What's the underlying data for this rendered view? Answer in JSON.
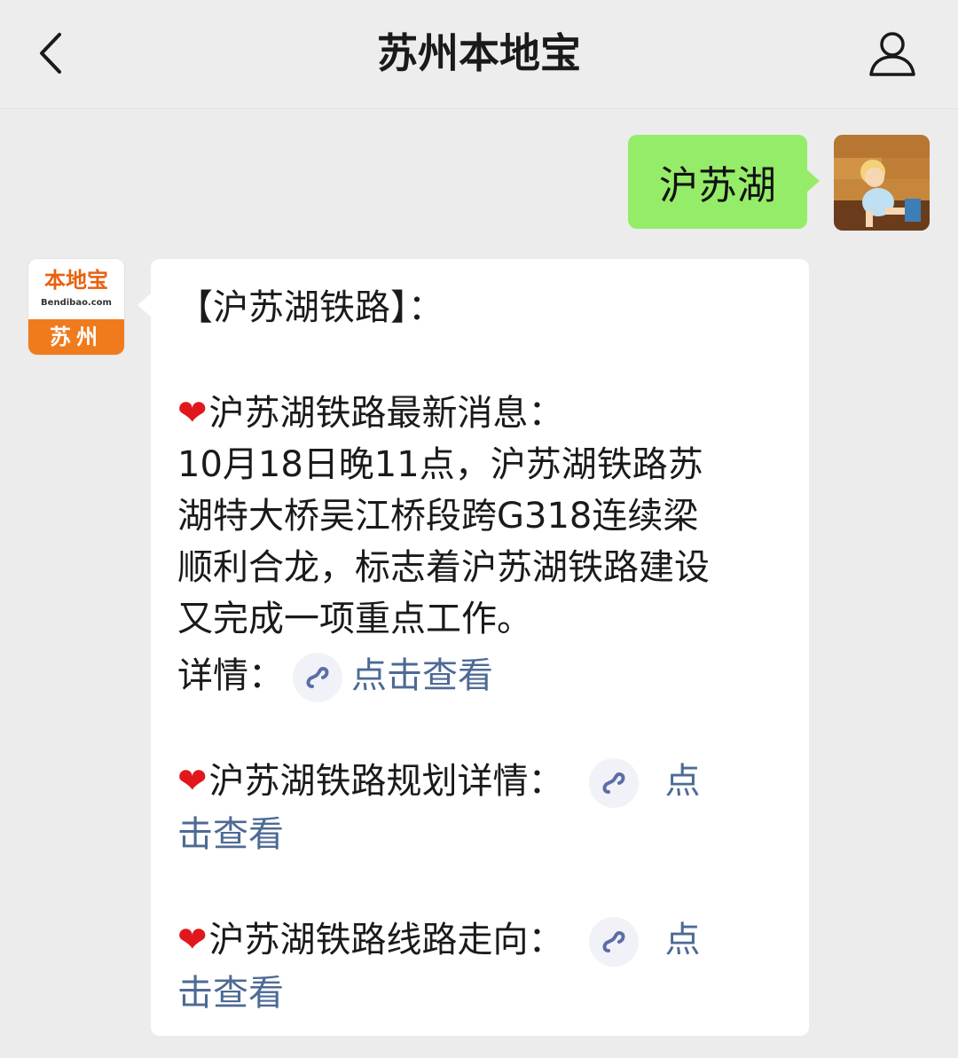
{
  "header": {
    "title": "苏州本地宝"
  },
  "icons": {
    "back": "chevron-left-icon",
    "profile": "person-icon",
    "link": "mini-program-link-icon"
  },
  "colors": {
    "sent_bubble": "#95ec69",
    "link": "#4d6a94",
    "heart": "#e0181d",
    "brand_orange": "#f07b1c"
  },
  "outgoing_message": {
    "text": "沪苏湖"
  },
  "account_avatar": {
    "logo_text": "本地宝",
    "logo_sub": "Bendibao.com",
    "city": "苏州"
  },
  "incoming_message": {
    "heading": "【沪苏湖铁路】：",
    "news_title": "沪苏湖铁路最新消息：",
    "news_lines": [
      "10月18日晚11点，沪苏湖铁路苏",
      "湖特大桥吴江桥段跨G318连续梁",
      "顺利合龙，标志着沪苏湖铁路建设",
      "又完成一项重点工作。"
    ],
    "detail_label": "详情：",
    "detail_link": "点击查看",
    "plan_title": "沪苏湖铁路规划详情：",
    "plan_link_a": "点",
    "plan_link_b": "击查看",
    "route_title": "沪苏湖铁路线路走向：",
    "route_link_a": "点",
    "route_link_b": "击查看",
    "heart_glyph": "❤"
  }
}
